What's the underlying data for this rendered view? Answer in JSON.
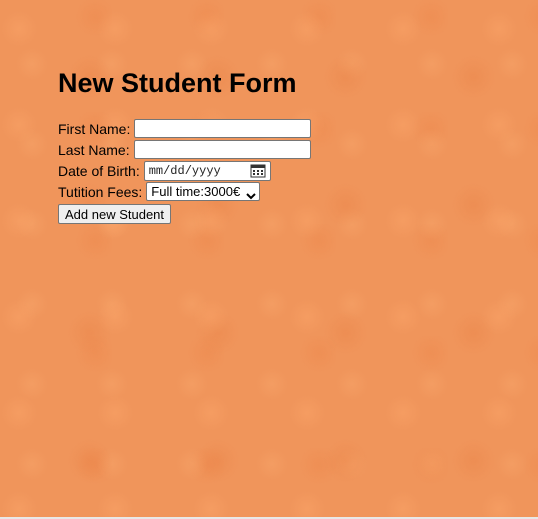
{
  "form": {
    "title": "New Student Form",
    "first_name": {
      "label": "First Name:",
      "value": ""
    },
    "last_name": {
      "label": "Last Name:",
      "value": ""
    },
    "date_of_birth": {
      "label": "Date of Birth:",
      "placeholder": "mm/dd/yyyy",
      "icon": "calendar-icon"
    },
    "tuition_fees": {
      "label": "Tutition Fees:",
      "selected": "Full time:3000€",
      "icon": "chevron-down-icon"
    },
    "submit_label": "Add new Student"
  }
}
